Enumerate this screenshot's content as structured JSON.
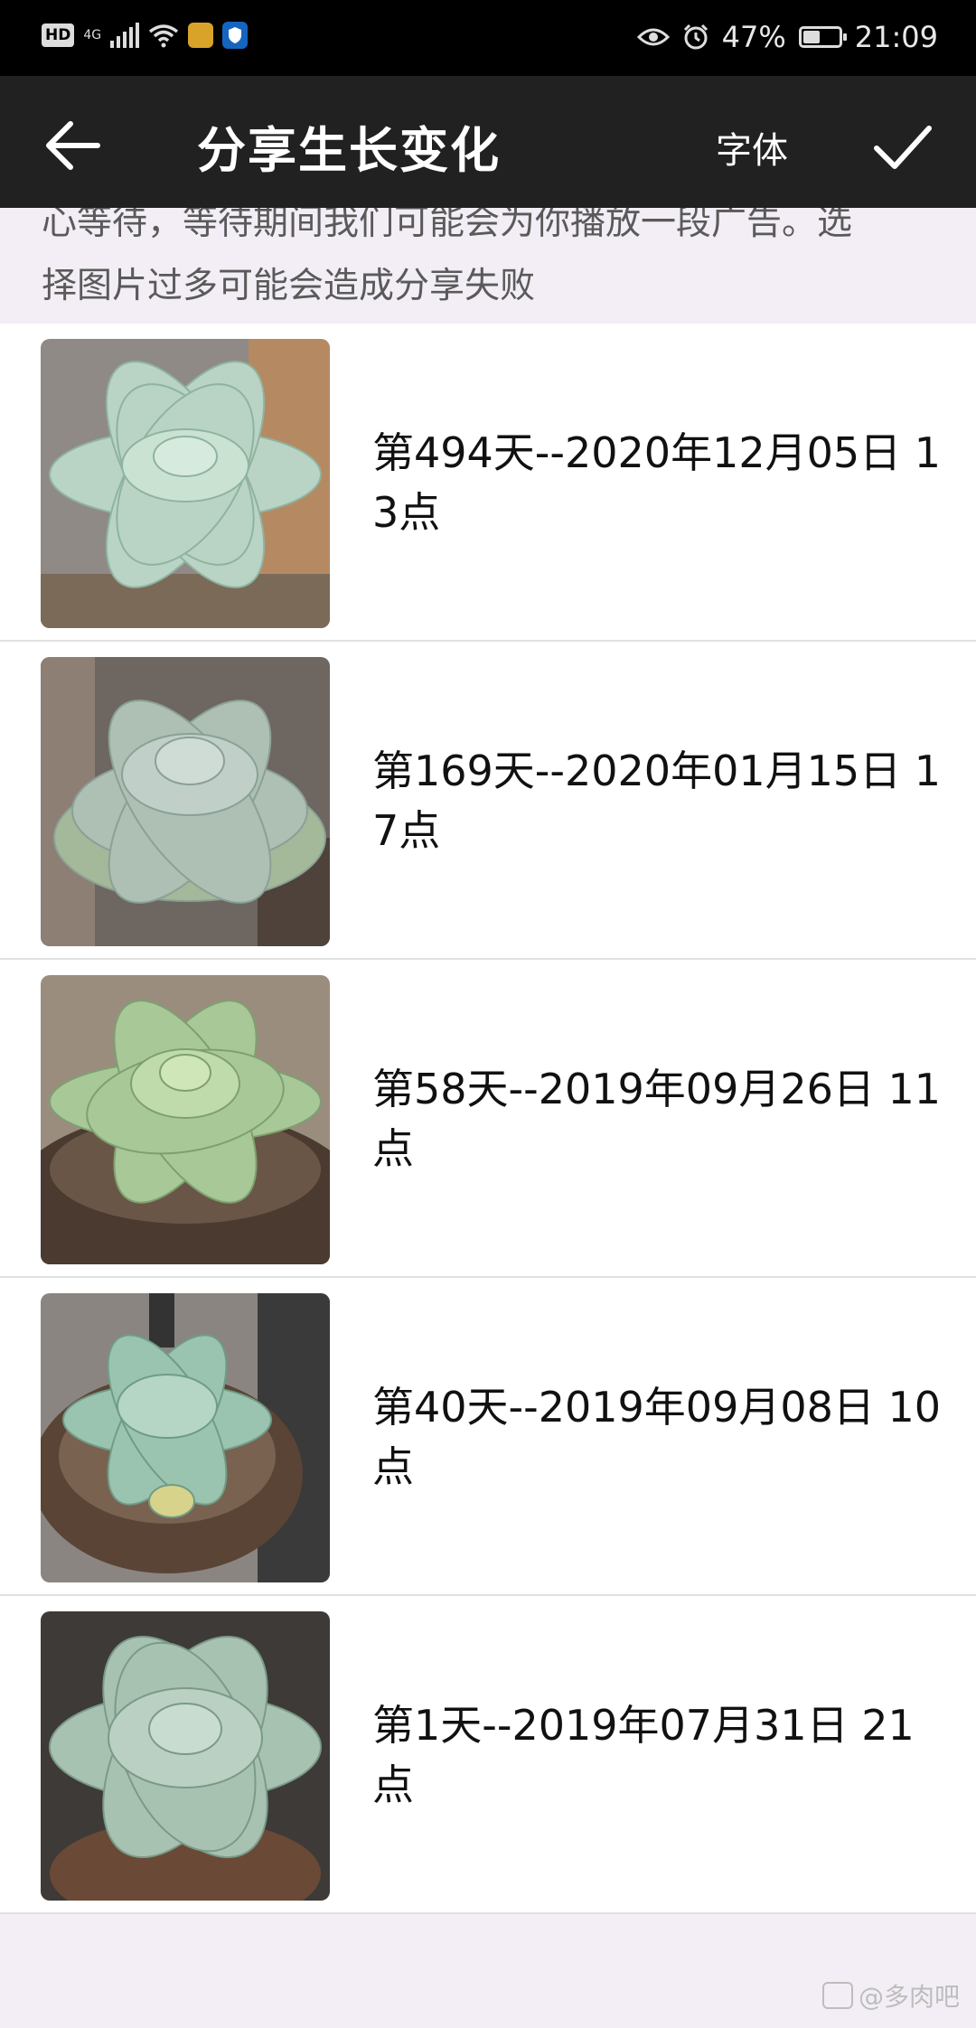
{
  "status_bar": {
    "hd_label": "HD",
    "network_label": "4G",
    "battery_percent": "47%",
    "battery_level": 0.47,
    "time": "21:09",
    "icons": [
      "hd-icon",
      "signal-icon",
      "wifi-icon",
      "app-notification-icon",
      "shield-icon",
      "eye-icon",
      "alarm-icon",
      "battery-icon"
    ]
  },
  "app_bar": {
    "back_icon": "back-arrow-icon",
    "title": "分享生长变化",
    "font_label": "字体",
    "confirm_icon": "check-icon"
  },
  "notice": {
    "text": "心等待，等待期间我们可能会为你播放一段广告。选择图片过多可能会造成分享失败"
  },
  "items": [
    {
      "caption": "第494天--2020年12月05日 13点"
    },
    {
      "caption": "第169天--2020年01月15日 17点"
    },
    {
      "caption": "第58天--2019年09月26日 11点"
    },
    {
      "caption": "第40天--2019年09月08日 10点"
    },
    {
      "caption": "第1天--2019年07月31日 21点"
    }
  ],
  "watermark": {
    "text": "@多肉吧"
  },
  "colors": {
    "app_bar": "#212121",
    "status_bar": "#000000",
    "background": "#f3eef5",
    "text": "#111111"
  }
}
